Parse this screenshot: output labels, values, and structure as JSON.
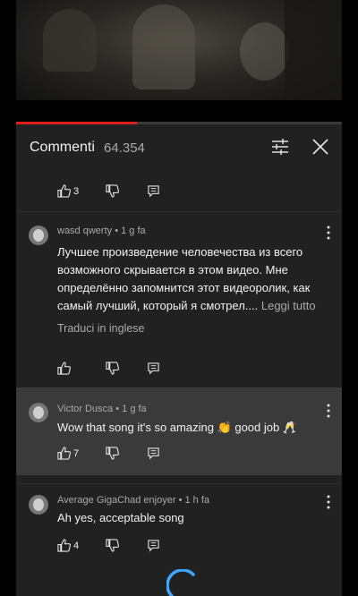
{
  "panel": {
    "title": "Commenti",
    "count": "64.354",
    "progress_fraction": 0.37
  },
  "comments": [
    {
      "likes": "3"
    },
    {
      "author": "wasd qwerty",
      "time": "1 g fa",
      "text": "Лучшее произведение человечества из всего возможного скрывается в этом видео. Мне определённо запомнится этот видеоролик, как самый лучший, который я смотрел....",
      "read_more": "Leggi tutto",
      "translate": "Traduci in inglese",
      "likes": ""
    },
    {
      "author": "Victor Dusca",
      "time": "1 g fa",
      "text": "Wow that song it's so amazing 👏 good job 🥂",
      "likes": "7"
    },
    {
      "author": "Average GigaChad enjoyer",
      "time": "1 h fa",
      "text": "Ah yes, acceptable song",
      "likes": "4"
    }
  ],
  "colors": {
    "accent": "#e01e1e",
    "panel_bg": "#212121",
    "highlight_bg": "#3a3a3a",
    "secondary_text": "#aaaaaa",
    "spinner": "#3ea6ff"
  },
  "icons": [
    "sort-icon",
    "close-icon",
    "thumb-up-icon",
    "thumb-down-icon",
    "reply-icon",
    "more-vert-icon",
    "loading-spinner"
  ]
}
